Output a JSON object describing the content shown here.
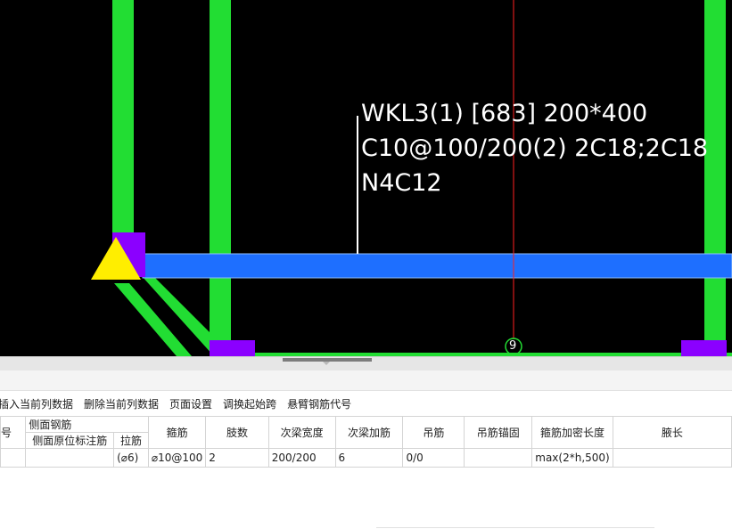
{
  "cad_view": {
    "annotation_lines": [
      "WKL3(1) [683] 200*400",
      "C10@100/200(2) 2C18;2C18",
      "N4C12"
    ],
    "axis_label": "9",
    "colors": {
      "background": "#000000",
      "column": "#22dd33",
      "selected_beam": "#1e6fff",
      "column_cap": "#8b00ff",
      "support_marker": "#ffee00",
      "axis_line": "#ff2020",
      "leader": "#ffffff"
    }
  },
  "toolbar": {
    "buttons": [
      "插入当前列数据",
      "删除当前列数据",
      "页面设置",
      "调换起始跨",
      "悬臂钢筋代号"
    ]
  },
  "table": {
    "col0_header": "号",
    "group_header": "侧面钢筋",
    "sub_header_1": "侧面原位标注筋",
    "sub_header_2": "拉筋",
    "headers": [
      "箍筋",
      "肢数",
      "次梁宽度",
      "次梁加筋",
      "吊筋",
      "吊筋锚固",
      "箍筋加密长度",
      "腋长"
    ],
    "row": {
      "col0": "",
      "side_bar": "",
      "tie_bar": "(⌀6)",
      "stirrup": "⌀10@100",
      "legs": "2",
      "secondary_width": "200/200",
      "secondary_add": "6",
      "hanger": "0/0",
      "hanger_anchor": "",
      "dense_length": "max(2*h,500)",
      "haunch": ""
    }
  }
}
